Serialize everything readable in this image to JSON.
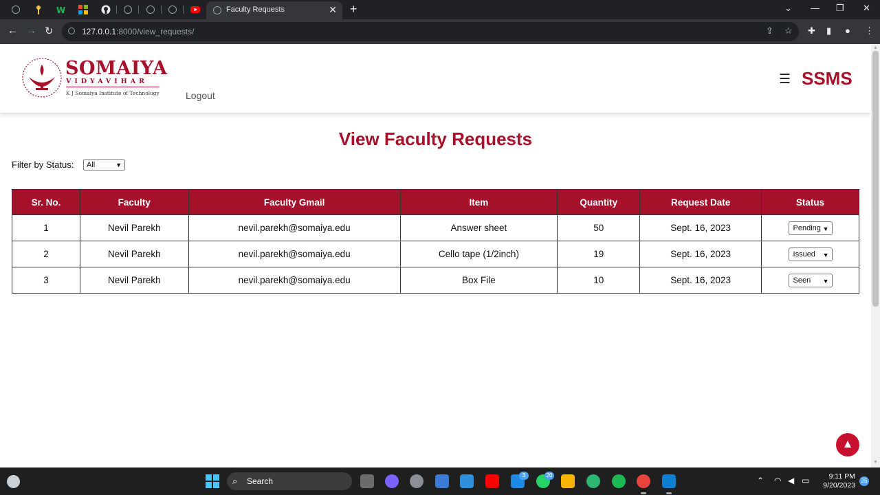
{
  "browser": {
    "active_tab_title": "Faculty Requests",
    "url_host": "127.0.0.1",
    "url_rest": ":8000/view_requests/",
    "pinned_tabs": [
      "globe-icon",
      "key-icon",
      "w-icon",
      "microsoft-icon",
      "github-icon",
      "globe-icon",
      "globe-icon",
      "globe-icon",
      "youtube-icon"
    ]
  },
  "header": {
    "brand_name": "SOMAIYA",
    "brand_sub": "VIDYAVIHAR",
    "brand_inst": "K J Somaiya Institute of Technology",
    "logout_label": "Logout",
    "menu_glyph": "☰",
    "app_name": "SSMS"
  },
  "main": {
    "title": "View Faculty Requests",
    "filter_label": "Filter by Status:",
    "filter_value": "All",
    "columns": [
      "Sr. No.",
      "Faculty",
      "Faculty Gmail",
      "Item",
      "Quantity",
      "Request Date",
      "Status"
    ],
    "rows": [
      {
        "sr": "1",
        "faculty": "Nevil Parekh",
        "gmail": "nevil.parekh@somaiya.edu",
        "item": "Answer sheet",
        "quantity": "50",
        "date": "Sept. 16, 2023",
        "status": "Pending"
      },
      {
        "sr": "2",
        "faculty": "Nevil Parekh",
        "gmail": "nevil.parekh@somaiya.edu",
        "item": "Cello tape (1/2inch)",
        "quantity": "19",
        "date": "Sept. 16, 2023",
        "status": "Issued"
      },
      {
        "sr": "3",
        "faculty": "Nevil Parekh",
        "gmail": "nevil.parekh@somaiya.edu",
        "item": "Box File",
        "quantity": "10",
        "date": "Sept. 16, 2023",
        "status": "Seen"
      }
    ]
  },
  "taskbar": {
    "search_label": "Search",
    "mail_badge": "3",
    "whatsapp_badge": "20",
    "time": "9:11 PM",
    "date": "9/20/2023",
    "notification_count": "25"
  },
  "colors": {
    "brand": "#a7102a",
    "scroll_top_button": "#c8102e"
  }
}
